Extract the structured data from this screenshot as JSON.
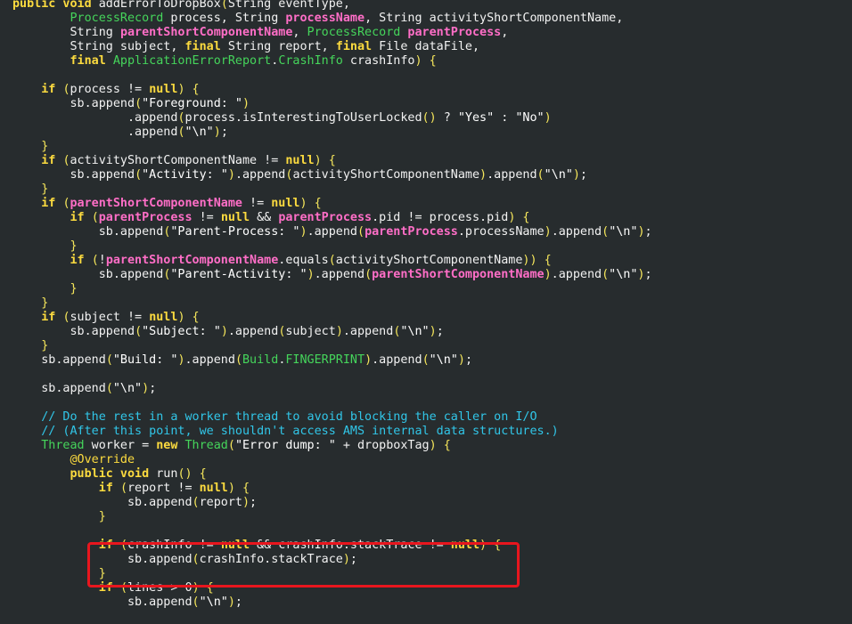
{
  "colors": {
    "background": "#272c2e",
    "keyword": "#fcdb3f",
    "type": "#45d55b",
    "param": "#ff6ec7",
    "comment": "#31c6e8",
    "text": "#f2f2f2",
    "highlight": "#e8161e"
  },
  "code_lines": [
    [
      [
        "kw",
        "public void "
      ],
      [
        "tx",
        "addErrorToDropBox"
      ],
      [
        "pu",
        "("
      ],
      [
        "tx",
        "String eventType,"
      ]
    ],
    [
      [
        "tx",
        "        "
      ],
      [
        "ty",
        "ProcessRecord"
      ],
      [
        "tx",
        " process, String "
      ],
      [
        "pm",
        "processName"
      ],
      [
        "tx",
        ", String activityShortComponentName,"
      ]
    ],
    [
      [
        "tx",
        "        String "
      ],
      [
        "pm",
        "parentShortComponentName"
      ],
      [
        "tx",
        ", "
      ],
      [
        "ty",
        "ProcessRecord"
      ],
      [
        "tx",
        " "
      ],
      [
        "pm",
        "parentProcess"
      ],
      [
        "tx",
        ","
      ]
    ],
    [
      [
        "tx",
        "        String subject, "
      ],
      [
        "kw",
        "final"
      ],
      [
        "tx",
        " String report, "
      ],
      [
        "kw",
        "final"
      ],
      [
        "tx",
        " File dataFile,"
      ]
    ],
    [
      [
        "tx",
        "        "
      ],
      [
        "kw",
        "final"
      ],
      [
        "tx",
        " "
      ],
      [
        "ty",
        "ApplicationErrorReport"
      ],
      [
        "tx",
        "."
      ],
      [
        "ty",
        "CrashInfo"
      ],
      [
        "tx",
        " crashInfo"
      ],
      [
        "pu",
        ") {"
      ]
    ],
    [
      [
        "tx",
        ""
      ]
    ],
    [
      [
        "tx",
        "    "
      ],
      [
        "kw",
        "if"
      ],
      [
        "tx",
        " "
      ],
      [
        "pu",
        "("
      ],
      [
        "tx",
        "process != "
      ],
      [
        "kw",
        "null"
      ],
      [
        "pu",
        ") {"
      ]
    ],
    [
      [
        "tx",
        "        sb.append"
      ],
      [
        "pu",
        "("
      ],
      [
        "st",
        "\"Foreground: \""
      ],
      [
        "pu",
        ")"
      ]
    ],
    [
      [
        "tx",
        "                .append"
      ],
      [
        "pu",
        "("
      ],
      [
        "tx",
        "process.isInterestingToUserLocked"
      ],
      [
        "pu",
        "()"
      ],
      [
        "tx",
        " ? "
      ],
      [
        "st",
        "\"Yes\""
      ],
      [
        "tx",
        " : "
      ],
      [
        "st",
        "\"No\""
      ],
      [
        "pu",
        ")"
      ]
    ],
    [
      [
        "tx",
        "                .append"
      ],
      [
        "pu",
        "("
      ],
      [
        "st",
        "\"\\n\""
      ],
      [
        "pu",
        ")"
      ],
      [
        "tx",
        ";"
      ]
    ],
    [
      [
        "tx",
        "    "
      ],
      [
        "pu",
        "}"
      ]
    ],
    [
      [
        "tx",
        "    "
      ],
      [
        "kw",
        "if"
      ],
      [
        "tx",
        " "
      ],
      [
        "pu",
        "("
      ],
      [
        "tx",
        "activityShortComponentName != "
      ],
      [
        "kw",
        "null"
      ],
      [
        "pu",
        ") {"
      ]
    ],
    [
      [
        "tx",
        "        sb.append"
      ],
      [
        "pu",
        "("
      ],
      [
        "st",
        "\"Activity: \""
      ],
      [
        "pu",
        ")"
      ],
      [
        "tx",
        ".append"
      ],
      [
        "pu",
        "("
      ],
      [
        "tx",
        "activityShortComponentName"
      ],
      [
        "pu",
        ")"
      ],
      [
        "tx",
        ".append"
      ],
      [
        "pu",
        "("
      ],
      [
        "st",
        "\"\\n\""
      ],
      [
        "pu",
        ")"
      ],
      [
        "tx",
        ";"
      ]
    ],
    [
      [
        "tx",
        "    "
      ],
      [
        "pu",
        "}"
      ]
    ],
    [
      [
        "tx",
        "    "
      ],
      [
        "kw",
        "if"
      ],
      [
        "tx",
        " "
      ],
      [
        "pu",
        "("
      ],
      [
        "pm",
        "parentShortComponentName"
      ],
      [
        "tx",
        " != "
      ],
      [
        "kw",
        "null"
      ],
      [
        "pu",
        ") {"
      ]
    ],
    [
      [
        "tx",
        "        "
      ],
      [
        "kw",
        "if"
      ],
      [
        "tx",
        " "
      ],
      [
        "pu",
        "("
      ],
      [
        "pm",
        "parentProcess"
      ],
      [
        "tx",
        " != "
      ],
      [
        "kw",
        "null"
      ],
      [
        "tx",
        " && "
      ],
      [
        "pm",
        "parentProcess"
      ],
      [
        "tx",
        ".pid != process.pid"
      ],
      [
        "pu",
        ") {"
      ]
    ],
    [
      [
        "tx",
        "            sb.append"
      ],
      [
        "pu",
        "("
      ],
      [
        "st",
        "\"Parent-Process: \""
      ],
      [
        "pu",
        ")"
      ],
      [
        "tx",
        ".append"
      ],
      [
        "pu",
        "("
      ],
      [
        "pm",
        "parentProcess"
      ],
      [
        "tx",
        ".processName"
      ],
      [
        "pu",
        ")"
      ],
      [
        "tx",
        ".append"
      ],
      [
        "pu",
        "("
      ],
      [
        "st",
        "\"\\n\""
      ],
      [
        "pu",
        ")"
      ],
      [
        "tx",
        ";"
      ]
    ],
    [
      [
        "tx",
        "        "
      ],
      [
        "pu",
        "}"
      ]
    ],
    [
      [
        "tx",
        "        "
      ],
      [
        "kw",
        "if"
      ],
      [
        "tx",
        " "
      ],
      [
        "pu",
        "("
      ],
      [
        "tx",
        "!"
      ],
      [
        "pm",
        "parentShortComponentName"
      ],
      [
        "tx",
        ".equals"
      ],
      [
        "pu",
        "("
      ],
      [
        "tx",
        "activityShortComponentName"
      ],
      [
        "pu",
        ")) {"
      ]
    ],
    [
      [
        "tx",
        "            sb.append"
      ],
      [
        "pu",
        "("
      ],
      [
        "st",
        "\"Parent-Activity: \""
      ],
      [
        "pu",
        ")"
      ],
      [
        "tx",
        ".append"
      ],
      [
        "pu",
        "("
      ],
      [
        "pm",
        "parentShortComponentName"
      ],
      [
        "pu",
        ")"
      ],
      [
        "tx",
        ".append"
      ],
      [
        "pu",
        "("
      ],
      [
        "st",
        "\"\\n\""
      ],
      [
        "pu",
        ")"
      ],
      [
        "tx",
        ";"
      ]
    ],
    [
      [
        "tx",
        "        "
      ],
      [
        "pu",
        "}"
      ]
    ],
    [
      [
        "tx",
        "    "
      ],
      [
        "pu",
        "}"
      ]
    ],
    [
      [
        "tx",
        "    "
      ],
      [
        "kw",
        "if"
      ],
      [
        "tx",
        " "
      ],
      [
        "pu",
        "("
      ],
      [
        "tx",
        "subject != "
      ],
      [
        "kw",
        "null"
      ],
      [
        "pu",
        ") {"
      ]
    ],
    [
      [
        "tx",
        "        sb.append"
      ],
      [
        "pu",
        "("
      ],
      [
        "st",
        "\"Subject: \""
      ],
      [
        "pu",
        ")"
      ],
      [
        "tx",
        ".append"
      ],
      [
        "pu",
        "("
      ],
      [
        "tx",
        "subject"
      ],
      [
        "pu",
        ")"
      ],
      [
        "tx",
        ".append"
      ],
      [
        "pu",
        "("
      ],
      [
        "st",
        "\"\\n\""
      ],
      [
        "pu",
        ")"
      ],
      [
        "tx",
        ";"
      ]
    ],
    [
      [
        "tx",
        "    "
      ],
      [
        "pu",
        "}"
      ]
    ],
    [
      [
        "tx",
        "    sb.append"
      ],
      [
        "pu",
        "("
      ],
      [
        "st",
        "\"Build: \""
      ],
      [
        "pu",
        ")"
      ],
      [
        "tx",
        ".append"
      ],
      [
        "pu",
        "("
      ],
      [
        "ty",
        "Build"
      ],
      [
        "tx",
        "."
      ],
      [
        "ty",
        "FINGERPRINT"
      ],
      [
        "pu",
        ")"
      ],
      [
        "tx",
        ".append"
      ],
      [
        "pu",
        "("
      ],
      [
        "st",
        "\"\\n\""
      ],
      [
        "pu",
        ")"
      ],
      [
        "tx",
        ";"
      ]
    ],
    [
      [
        "tx",
        ""
      ]
    ],
    [
      [
        "tx",
        "    sb.append"
      ],
      [
        "pu",
        "("
      ],
      [
        "st",
        "\"\\n\""
      ],
      [
        "pu",
        ")"
      ],
      [
        "tx",
        ";"
      ]
    ],
    [
      [
        "tx",
        ""
      ]
    ],
    [
      [
        "tx",
        "    "
      ],
      [
        "cm",
        "// Do the rest in a worker thread to avoid blocking the caller on I/O"
      ]
    ],
    [
      [
        "tx",
        "    "
      ],
      [
        "cm",
        "// (After this point, we shouldn't access AMS internal data structures.)"
      ]
    ],
    [
      [
        "tx",
        "    "
      ],
      [
        "ty",
        "Thread"
      ],
      [
        "tx",
        " worker = "
      ],
      [
        "kw",
        "new"
      ],
      [
        "tx",
        " "
      ],
      [
        "ty",
        "Thread"
      ],
      [
        "pu",
        "("
      ],
      [
        "st",
        "\"Error dump: \""
      ],
      [
        "tx",
        " + dropboxTag"
      ],
      [
        "pu",
        ") {"
      ]
    ],
    [
      [
        "tx",
        "        "
      ],
      [
        "an",
        "@Override"
      ]
    ],
    [
      [
        "tx",
        "        "
      ],
      [
        "kw",
        "public void"
      ],
      [
        "tx",
        " run"
      ],
      [
        "pu",
        "() {"
      ]
    ],
    [
      [
        "tx",
        "            "
      ],
      [
        "kw",
        "if"
      ],
      [
        "tx",
        " "
      ],
      [
        "pu",
        "("
      ],
      [
        "tx",
        "report != "
      ],
      [
        "kw",
        "null"
      ],
      [
        "pu",
        ") {"
      ]
    ],
    [
      [
        "tx",
        "                sb.append"
      ],
      [
        "pu",
        "("
      ],
      [
        "tx",
        "report"
      ],
      [
        "pu",
        ")"
      ],
      [
        "tx",
        ";"
      ]
    ],
    [
      [
        "tx",
        "            "
      ],
      [
        "pu",
        "}"
      ]
    ],
    [
      [
        "tx",
        ""
      ]
    ],
    [
      [
        "tx",
        "            "
      ],
      [
        "kw",
        "if"
      ],
      [
        "tx",
        " "
      ],
      [
        "pu",
        "("
      ],
      [
        "tx",
        "crashInfo != "
      ],
      [
        "kw",
        "null"
      ],
      [
        "tx",
        " && crashInfo.stackTrace != "
      ],
      [
        "kw",
        "null"
      ],
      [
        "pu",
        ") {"
      ]
    ],
    [
      [
        "tx",
        "                sb.append"
      ],
      [
        "pu",
        "("
      ],
      [
        "tx",
        "crashInfo.stackTrace"
      ],
      [
        "pu",
        ")"
      ],
      [
        "tx",
        ";"
      ]
    ],
    [
      [
        "tx",
        "            "
      ],
      [
        "pu",
        "}"
      ]
    ],
    [
      [
        "tx",
        "            "
      ],
      [
        "kw",
        "if"
      ],
      [
        "tx",
        " "
      ],
      [
        "pu",
        "("
      ],
      [
        "tx",
        "lines > 0"
      ],
      [
        "pu",
        ") {"
      ]
    ],
    [
      [
        "tx",
        "                sb.append"
      ],
      [
        "pu",
        "("
      ],
      [
        "st",
        "\"\\n\""
      ],
      [
        "pu",
        ")"
      ],
      [
        "tx",
        ";"
      ]
    ]
  ]
}
